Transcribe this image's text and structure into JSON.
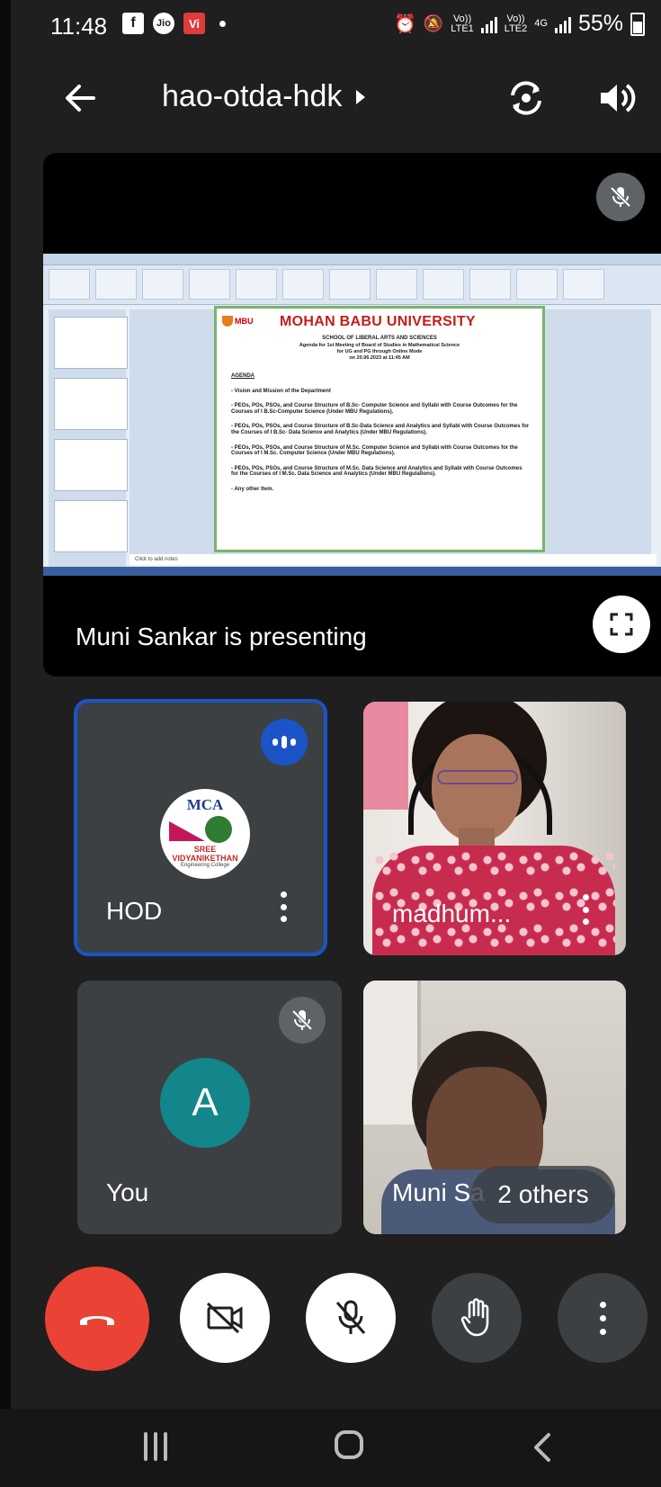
{
  "status_bar": {
    "time": "11:48",
    "network_1": "Vo))\nLTE1",
    "network_2": "Vo))\nLTE2",
    "network_3": "4G",
    "battery": "55%"
  },
  "header": {
    "meeting_code": "hao-otda-hdk",
    "icons": [
      "back-arrow-icon",
      "switch-camera-icon",
      "speaker-icon"
    ]
  },
  "presentation": {
    "presenting_label": "Muni Sankar is presenting",
    "slide": {
      "logo_text": "MBU",
      "university": "MOHAN BABU UNIVERSITY",
      "school": "SCHOOL OF LIBERAL ARTS AND SCIENCES",
      "agenda_title": "Agenda for 1st Meeting of Board of Studies in Mathematical Science",
      "agenda_sub": "for UG and PG through Online Mode",
      "agenda_date": "on 20.06.2023 at 11:45 AM",
      "agenda_heading": "AGENDA",
      "items": [
        "- Vision and Mission of the Department",
        "- PEOs, POs, PSOs, and Course Structure of B.Sc- Computer Science and Syllabi with Course Outcomes for the Courses of I B.Sc-Computer Science (Under MBU Regulations).",
        "- PEOs, POs, PSOs, and Course Structure of B.Sc-Data Science and Analytics and Syllabi with Course Outcomes for the Courses of I B.Sc- Data Science and Analytics (Under MBU Regulations).",
        "- PEOs, POs, PSOs, and Course Structure of M.Sc. Computer Science and Syllabi with Course Outcomes for the Courses of I M.Sc. Computer Science (Under MBU Regulations).",
        "- PEOs, POs, PSOs, and Course Structure of M.Sc. Data Science and Analytics and Syllabi with Course Outcomes for the Courses of I M.Sc. Data Science and Analytics (Under MBU Regulations).",
        "- Any other Item."
      ],
      "notes_placeholder": "Click to add notes"
    }
  },
  "participants": {
    "hod": {
      "name": "HOD",
      "logo_top": "MCA",
      "logo_middle": "SREE VIDYANIKETHAN",
      "logo_bottom": "Engineering College"
    },
    "madhu": {
      "name": "madhum..."
    },
    "you": {
      "name": "You",
      "initial": "A"
    },
    "muni": {
      "name": "Muni Sa",
      "others": "2 others"
    }
  },
  "colors": {
    "accent_blue": "#1a54c7",
    "end_call_red": "#ea4335",
    "tile_bg": "#3c4043",
    "avatar_teal": "#12868a"
  }
}
